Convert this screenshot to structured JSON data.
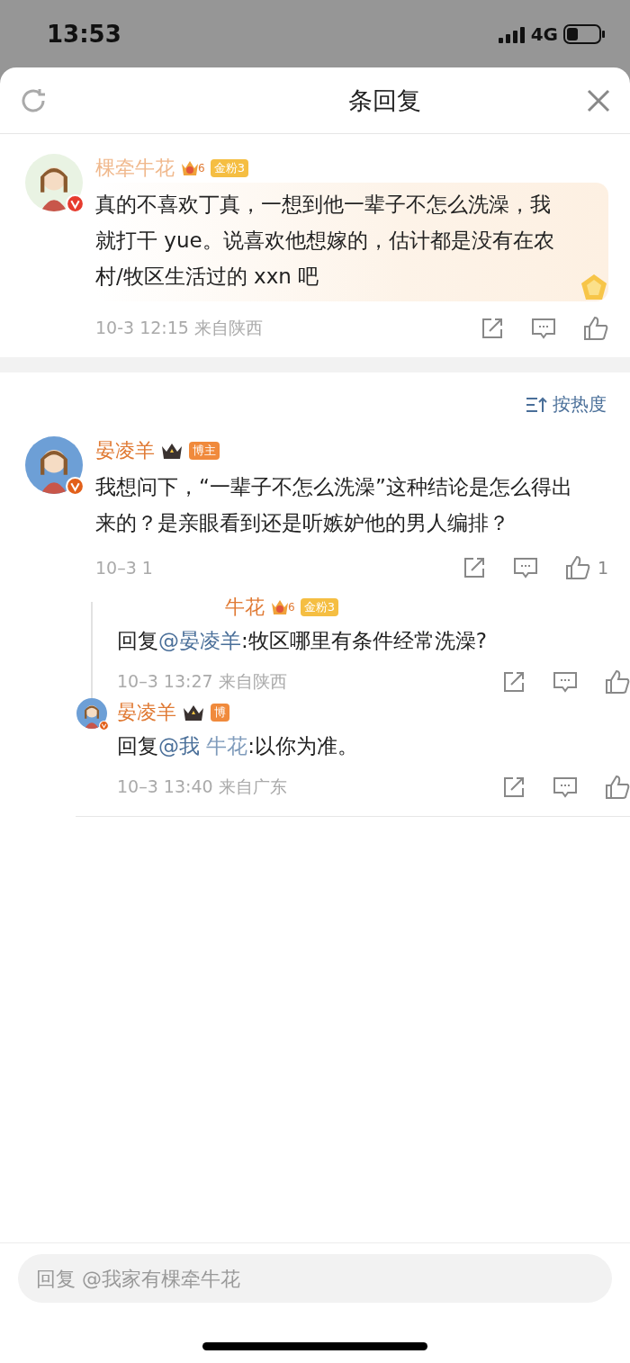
{
  "status_bar": {
    "time": "13:53",
    "network": "4G"
  },
  "header": {
    "title": "条回复"
  },
  "root_comment": {
    "name": "棵牵牛花",
    "badge": {
      "kind": "fan",
      "level_digit": "6",
      "label": "金粉3"
    },
    "verified": true,
    "text": "真的不喜欢丁真，一想到他一辈子不怎么洗澡，我就打干 yue。说喜欢他想嫁的，估计都是没有在农村/牧区生活过的 xxn 吧",
    "time": "10-3 12:15",
    "location": "来自陕西"
  },
  "sort": {
    "label": "按热度"
  },
  "comments": [
    {
      "name": "晏凌羊",
      "badge": {
        "kind": "host",
        "label": "博主"
      },
      "verified": true,
      "text": "我想问下，“一辈子不怎么洗澡”这种结论是怎么得出来的？是亲眼看到还是听嫉妒他的男人编排？",
      "time": "10–3 1",
      "likes": "1",
      "replies": [
        {
          "name": "牛花",
          "avatar": false,
          "badge": {
            "kind": "fan",
            "level_digit": "6",
            "label": "金粉3"
          },
          "prefix": "回复",
          "mention": "@晏凌羊",
          "body": ":牧区哪里有条件经常洗澡?",
          "time": "10–3 13:27",
          "location": "来自陕西"
        },
        {
          "name": "晏凌羊",
          "avatar": true,
          "badge": {
            "kind": "host",
            "label": "博"
          },
          "prefix": "回复",
          "mention": "@我",
          "mention_tail": "牛花",
          "body": ":以你为准。",
          "time": "10–3 13:40",
          "location": "来自广东"
        }
      ]
    }
  ],
  "reply_input": {
    "placeholder": "回复 @我家有棵牵牛花"
  }
}
